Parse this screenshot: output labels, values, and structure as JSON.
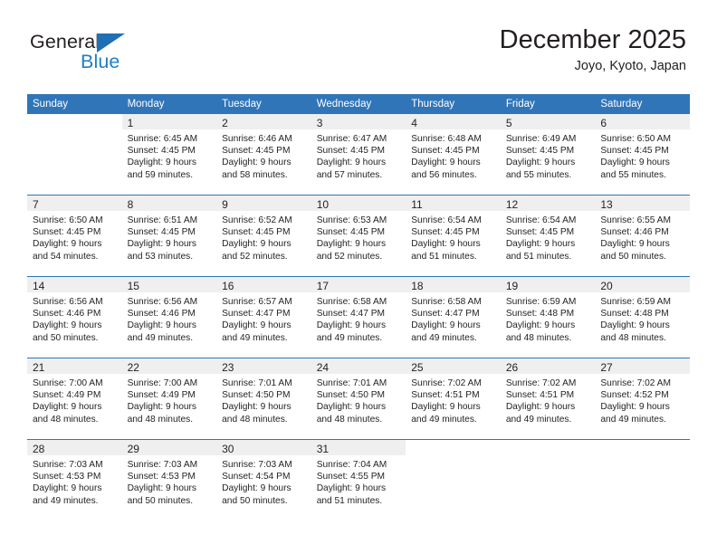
{
  "brand": {
    "name_part1": "General",
    "name_part2": "Blue",
    "triangle_icon": "triangle-icon",
    "colors": {
      "dark": "#231f20",
      "blue": "#1f7fc4",
      "triangle": "#1f6fb4"
    }
  },
  "header": {
    "title": "December 2025",
    "subtitle": "Joyo, Kyoto, Japan"
  },
  "theme": {
    "header_bar": "#3075b8",
    "daynum_band": "#efefef",
    "cell_background": "#ffffff",
    "text": "#231f20"
  },
  "weekdays": [
    "Sunday",
    "Monday",
    "Tuesday",
    "Wednesday",
    "Thursday",
    "Friday",
    "Saturday"
  ],
  "weeks": [
    [
      {
        "day": ""
      },
      {
        "day": "1",
        "sunrise": "Sunrise: 6:45 AM",
        "sunset": "Sunset: 4:45 PM",
        "daylight1": "Daylight: 9 hours",
        "daylight2": "and 59 minutes."
      },
      {
        "day": "2",
        "sunrise": "Sunrise: 6:46 AM",
        "sunset": "Sunset: 4:45 PM",
        "daylight1": "Daylight: 9 hours",
        "daylight2": "and 58 minutes."
      },
      {
        "day": "3",
        "sunrise": "Sunrise: 6:47 AM",
        "sunset": "Sunset: 4:45 PM",
        "daylight1": "Daylight: 9 hours",
        "daylight2": "and 57 minutes."
      },
      {
        "day": "4",
        "sunrise": "Sunrise: 6:48 AM",
        "sunset": "Sunset: 4:45 PM",
        "daylight1": "Daylight: 9 hours",
        "daylight2": "and 56 minutes."
      },
      {
        "day": "5",
        "sunrise": "Sunrise: 6:49 AM",
        "sunset": "Sunset: 4:45 PM",
        "daylight1": "Daylight: 9 hours",
        "daylight2": "and 55 minutes."
      },
      {
        "day": "6",
        "sunrise": "Sunrise: 6:50 AM",
        "sunset": "Sunset: 4:45 PM",
        "daylight1": "Daylight: 9 hours",
        "daylight2": "and 55 minutes."
      }
    ],
    [
      {
        "day": "7",
        "sunrise": "Sunrise: 6:50 AM",
        "sunset": "Sunset: 4:45 PM",
        "daylight1": "Daylight: 9 hours",
        "daylight2": "and 54 minutes."
      },
      {
        "day": "8",
        "sunrise": "Sunrise: 6:51 AM",
        "sunset": "Sunset: 4:45 PM",
        "daylight1": "Daylight: 9 hours",
        "daylight2": "and 53 minutes."
      },
      {
        "day": "9",
        "sunrise": "Sunrise: 6:52 AM",
        "sunset": "Sunset: 4:45 PM",
        "daylight1": "Daylight: 9 hours",
        "daylight2": "and 52 minutes."
      },
      {
        "day": "10",
        "sunrise": "Sunrise: 6:53 AM",
        "sunset": "Sunset: 4:45 PM",
        "daylight1": "Daylight: 9 hours",
        "daylight2": "and 52 minutes."
      },
      {
        "day": "11",
        "sunrise": "Sunrise: 6:54 AM",
        "sunset": "Sunset: 4:45 PM",
        "daylight1": "Daylight: 9 hours",
        "daylight2": "and 51 minutes."
      },
      {
        "day": "12",
        "sunrise": "Sunrise: 6:54 AM",
        "sunset": "Sunset: 4:45 PM",
        "daylight1": "Daylight: 9 hours",
        "daylight2": "and 51 minutes."
      },
      {
        "day": "13",
        "sunrise": "Sunrise: 6:55 AM",
        "sunset": "Sunset: 4:46 PM",
        "daylight1": "Daylight: 9 hours",
        "daylight2": "and 50 minutes."
      }
    ],
    [
      {
        "day": "14",
        "sunrise": "Sunrise: 6:56 AM",
        "sunset": "Sunset: 4:46 PM",
        "daylight1": "Daylight: 9 hours",
        "daylight2": "and 50 minutes."
      },
      {
        "day": "15",
        "sunrise": "Sunrise: 6:56 AM",
        "sunset": "Sunset: 4:46 PM",
        "daylight1": "Daylight: 9 hours",
        "daylight2": "and 49 minutes."
      },
      {
        "day": "16",
        "sunrise": "Sunrise: 6:57 AM",
        "sunset": "Sunset: 4:47 PM",
        "daylight1": "Daylight: 9 hours",
        "daylight2": "and 49 minutes."
      },
      {
        "day": "17",
        "sunrise": "Sunrise: 6:58 AM",
        "sunset": "Sunset: 4:47 PM",
        "daylight1": "Daylight: 9 hours",
        "daylight2": "and 49 minutes."
      },
      {
        "day": "18",
        "sunrise": "Sunrise: 6:58 AM",
        "sunset": "Sunset: 4:47 PM",
        "daylight1": "Daylight: 9 hours",
        "daylight2": "and 49 minutes."
      },
      {
        "day": "19",
        "sunrise": "Sunrise: 6:59 AM",
        "sunset": "Sunset: 4:48 PM",
        "daylight1": "Daylight: 9 hours",
        "daylight2": "and 48 minutes."
      },
      {
        "day": "20",
        "sunrise": "Sunrise: 6:59 AM",
        "sunset": "Sunset: 4:48 PM",
        "daylight1": "Daylight: 9 hours",
        "daylight2": "and 48 minutes."
      }
    ],
    [
      {
        "day": "21",
        "sunrise": "Sunrise: 7:00 AM",
        "sunset": "Sunset: 4:49 PM",
        "daylight1": "Daylight: 9 hours",
        "daylight2": "and 48 minutes."
      },
      {
        "day": "22",
        "sunrise": "Sunrise: 7:00 AM",
        "sunset": "Sunset: 4:49 PM",
        "daylight1": "Daylight: 9 hours",
        "daylight2": "and 48 minutes."
      },
      {
        "day": "23",
        "sunrise": "Sunrise: 7:01 AM",
        "sunset": "Sunset: 4:50 PM",
        "daylight1": "Daylight: 9 hours",
        "daylight2": "and 48 minutes."
      },
      {
        "day": "24",
        "sunrise": "Sunrise: 7:01 AM",
        "sunset": "Sunset: 4:50 PM",
        "daylight1": "Daylight: 9 hours",
        "daylight2": "and 48 minutes."
      },
      {
        "day": "25",
        "sunrise": "Sunrise: 7:02 AM",
        "sunset": "Sunset: 4:51 PM",
        "daylight1": "Daylight: 9 hours",
        "daylight2": "and 49 minutes."
      },
      {
        "day": "26",
        "sunrise": "Sunrise: 7:02 AM",
        "sunset": "Sunset: 4:51 PM",
        "daylight1": "Daylight: 9 hours",
        "daylight2": "and 49 minutes."
      },
      {
        "day": "27",
        "sunrise": "Sunrise: 7:02 AM",
        "sunset": "Sunset: 4:52 PM",
        "daylight1": "Daylight: 9 hours",
        "daylight2": "and 49 minutes."
      }
    ],
    [
      {
        "day": "28",
        "sunrise": "Sunrise: 7:03 AM",
        "sunset": "Sunset: 4:53 PM",
        "daylight1": "Daylight: 9 hours",
        "daylight2": "and 49 minutes."
      },
      {
        "day": "29",
        "sunrise": "Sunrise: 7:03 AM",
        "sunset": "Sunset: 4:53 PM",
        "daylight1": "Daylight: 9 hours",
        "daylight2": "and 50 minutes."
      },
      {
        "day": "30",
        "sunrise": "Sunrise: 7:03 AM",
        "sunset": "Sunset: 4:54 PM",
        "daylight1": "Daylight: 9 hours",
        "daylight2": "and 50 minutes."
      },
      {
        "day": "31",
        "sunrise": "Sunrise: 7:04 AM",
        "sunset": "Sunset: 4:55 PM",
        "daylight1": "Daylight: 9 hours",
        "daylight2": "and 51 minutes."
      },
      {
        "day": ""
      },
      {
        "day": ""
      },
      {
        "day": ""
      }
    ]
  ]
}
